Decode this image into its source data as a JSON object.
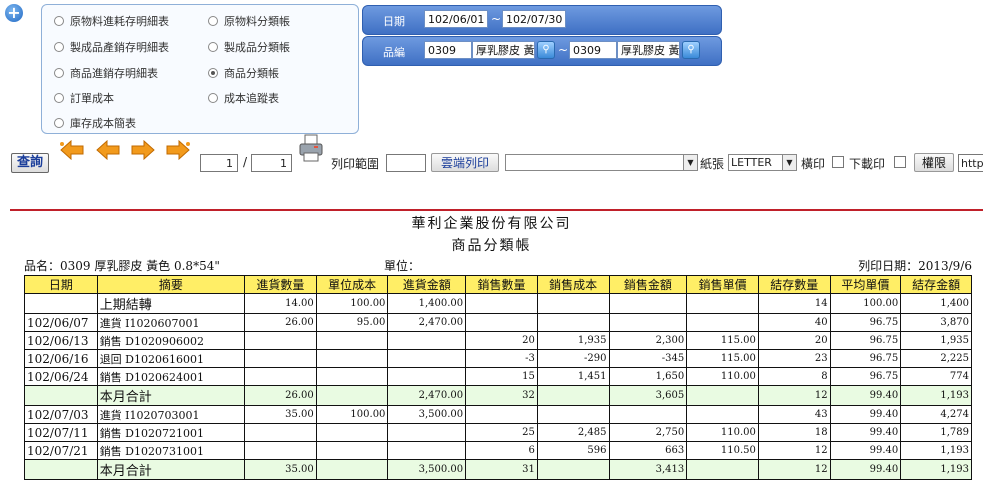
{
  "report_options": {
    "left": [
      "原物料進耗存明細表",
      "製成品產銷存明細表",
      "商品進銷存明細表",
      "訂單成本",
      "庫存成本簡表"
    ],
    "right": [
      "原物料分類帳",
      "製成品分類帳",
      "商品分類帳",
      "成本追蹤表"
    ],
    "selected": "商品分類帳"
  },
  "filters": {
    "date_label": "日期",
    "date_from": "102/06/01",
    "date_to": "102/07/30",
    "tilde": "~",
    "item_label": "品編",
    "item_from_code": "0309",
    "item_from_name": "厚乳膠皮 黃",
    "item_to_code": "0309",
    "item_to_name": "厚乳膠皮 黃"
  },
  "toolbar": {
    "query": "查詢",
    "page_current": "1",
    "page_sep": "/",
    "page_total": "1",
    "print_range_label": "列印範圍",
    "print_range_value": "",
    "cloud_print": "雲端列印",
    "printer_select": "",
    "paper_label": "紙張",
    "paper_value": "LETTER",
    "landscape_label": "橫印",
    "download_label": "下載印",
    "permission": "權限",
    "url_text": "http"
  },
  "report": {
    "company": "華利企業股份有限公司",
    "title": "商品分類帳",
    "item_line": "品名：0309  厚乳膠皮 黃色 0.8*54\"",
    "unit_label": "單位：",
    "print_date": "列印日期：2013/9/6",
    "columns": [
      "日期",
      "摘要",
      "進貨數量",
      "單位成本",
      "進貨金額",
      "銷售數量",
      "銷售成本",
      "銷售金額",
      "銷售單價",
      "結存數量",
      "平均單價",
      "結存金額"
    ],
    "rows": [
      {
        "type": "row",
        "cells": [
          "",
          "上期結轉",
          "14.00",
          "100.00",
          "1,400.00",
          "",
          "",
          "",
          "",
          "14",
          "100.00",
          "1,400"
        ]
      },
      {
        "type": "row",
        "cells": [
          "102/06/07",
          "進貨 I1020607001",
          "26.00",
          "95.00",
          "2,470.00",
          "",
          "",
          "",
          "",
          "40",
          "96.75",
          "3,870"
        ]
      },
      {
        "type": "row",
        "cells": [
          "102/06/13",
          "銷售 D1020906002",
          "",
          "",
          "",
          "20",
          "1,935",
          "2,300",
          "115.00",
          "20",
          "96.75",
          "1,935"
        ]
      },
      {
        "type": "row",
        "cells": [
          "102/06/16",
          "退回 D1020616001",
          "",
          "",
          "",
          "-3",
          "-290",
          "-345",
          "115.00",
          "23",
          "96.75",
          "2,225"
        ]
      },
      {
        "type": "row",
        "cells": [
          "102/06/24",
          "銷售 D1020624001",
          "",
          "",
          "",
          "15",
          "1,451",
          "1,650",
          "110.00",
          "8",
          "96.75",
          "774"
        ]
      },
      {
        "type": "sub",
        "cells": [
          "",
          "本月合計",
          "26.00",
          "",
          "2,470.00",
          "32",
          "",
          "3,605",
          "",
          "12",
          "99.40",
          "1,193"
        ]
      },
      {
        "type": "row",
        "cells": [
          "102/07/03",
          "進貨 I1020703001",
          "35.00",
          "100.00",
          "3,500.00",
          "",
          "",
          "",
          "",
          "43",
          "99.40",
          "4,274"
        ]
      },
      {
        "type": "row",
        "cells": [
          "102/07/11",
          "銷售 D1020721001",
          "",
          "",
          "",
          "25",
          "2,485",
          "2,750",
          "110.00",
          "18",
          "99.40",
          "1,789"
        ]
      },
      {
        "type": "row",
        "cells": [
          "102/07/21",
          "銷售 D1020731001",
          "",
          "",
          "",
          "6",
          "596",
          "663",
          "110.50",
          "12",
          "99.40",
          "1,193"
        ]
      },
      {
        "type": "sub",
        "cells": [
          "",
          "本月合計",
          "35.00",
          "",
          "3,500.00",
          "31",
          "",
          "3,413",
          "",
          "12",
          "99.40",
          "1,193"
        ]
      }
    ]
  }
}
